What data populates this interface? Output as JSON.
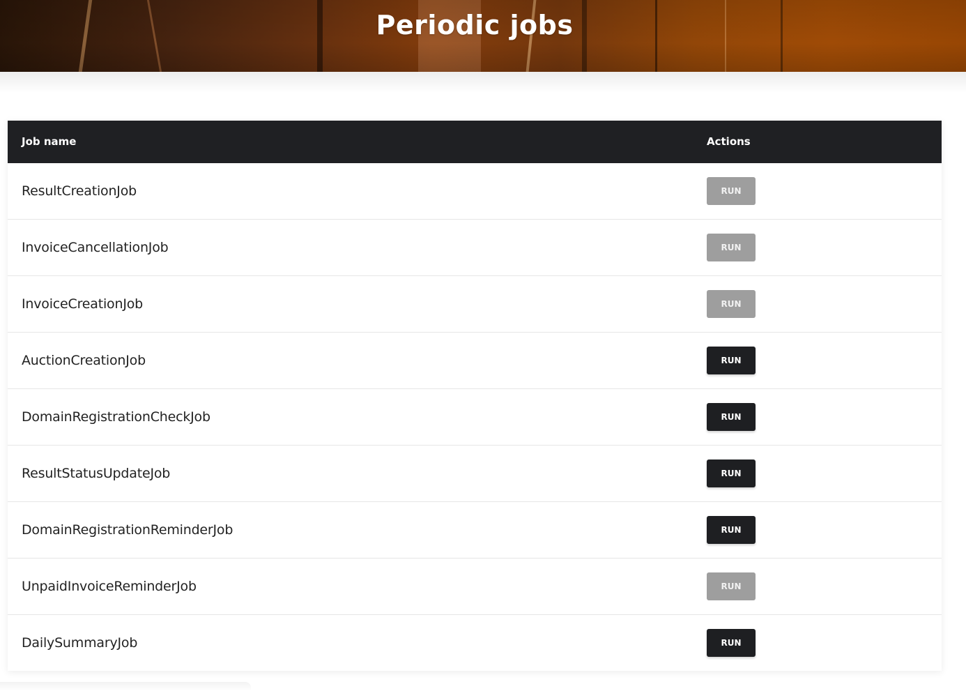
{
  "header": {
    "title": "Periodic jobs"
  },
  "table": {
    "columns": {
      "job_name": "Job name",
      "actions": "Actions"
    },
    "rows": [
      {
        "name": "ResultCreationJob",
        "action_label": "RUN",
        "enabled": false
      },
      {
        "name": "InvoiceCancellationJob",
        "action_label": "RUN",
        "enabled": false
      },
      {
        "name": "InvoiceCreationJob",
        "action_label": "RUN",
        "enabled": false
      },
      {
        "name": "AuctionCreationJob",
        "action_label": "RUN",
        "enabled": true
      },
      {
        "name": "DomainRegistrationCheckJob",
        "action_label": "RUN",
        "enabled": true
      },
      {
        "name": "ResultStatusUpdateJob",
        "action_label": "RUN",
        "enabled": true
      },
      {
        "name": "DomainRegistrationReminderJob",
        "action_label": "RUN",
        "enabled": true
      },
      {
        "name": "UnpaidInvoiceReminderJob",
        "action_label": "RUN",
        "enabled": false
      },
      {
        "name": "DailySummaryJob",
        "action_label": "RUN",
        "enabled": true
      }
    ]
  },
  "colors": {
    "header_bg": "#1f2023",
    "button_enabled": "#1e1f22",
    "button_disabled": "#9e9e9e",
    "hero_accent": "#a04a04"
  }
}
